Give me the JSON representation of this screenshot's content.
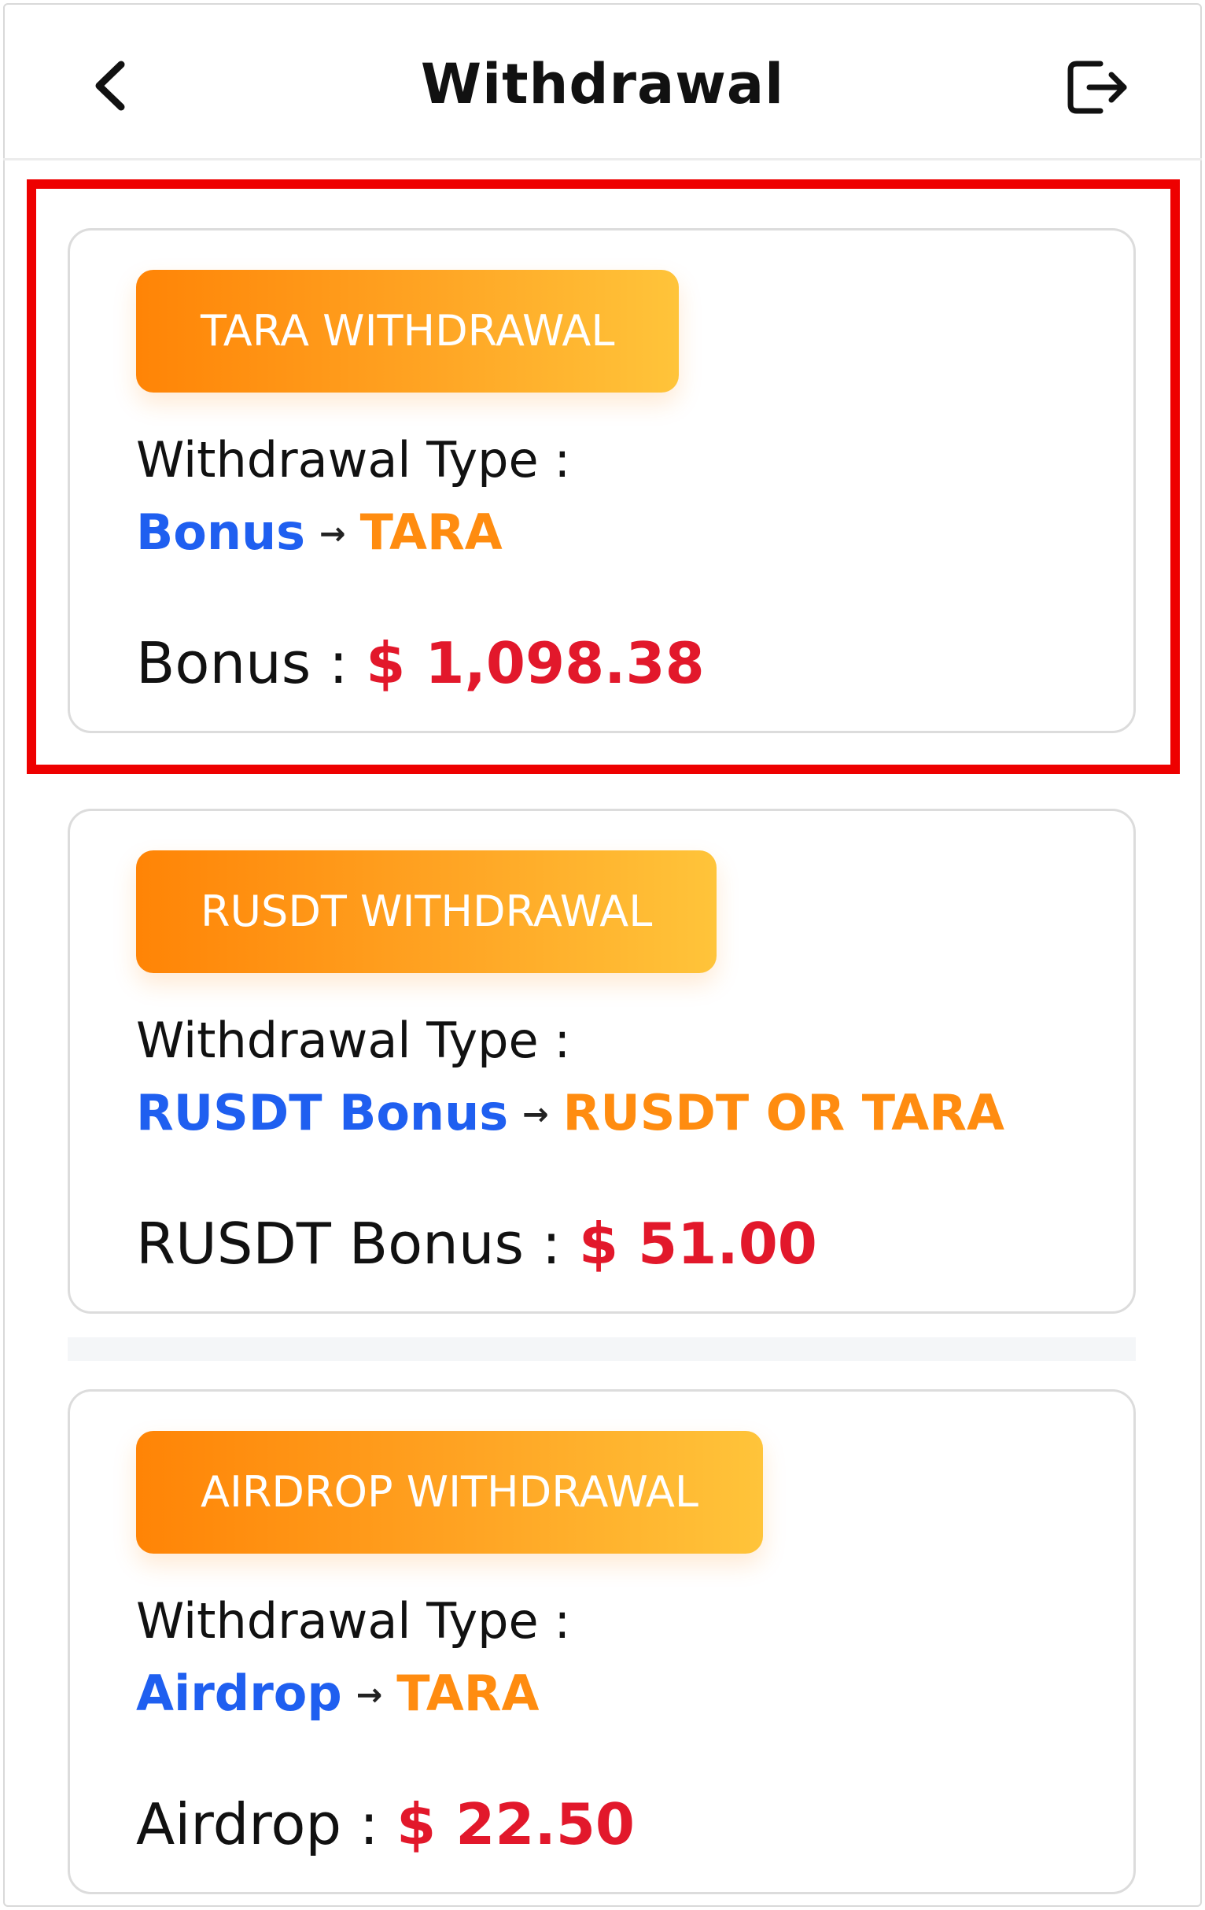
{
  "header": {
    "title": "Withdrawal",
    "back_icon": "chevron-left-icon",
    "logout_icon": "logout-icon"
  },
  "colors": {
    "source": "#1f5ff0",
    "destination": "#ff8c10",
    "amount": "#e2182b",
    "highlight": "#ee0000",
    "badge_start": "#ff8406",
    "badge_end": "#ffc43a"
  },
  "cards": [
    {
      "badge": "TARA WITHDRAWAL",
      "type_label": "Withdrawal Type :",
      "from": "Bonus",
      "arrow": "→",
      "to": "TARA",
      "amount_label": "Bonus :",
      "amount": "$ 1,098.38"
    },
    {
      "badge": "RUSDT WITHDRAWAL",
      "type_label": "Withdrawal Type :",
      "from": "RUSDT Bonus",
      "arrow": "→",
      "to": "RUSDT OR TARA",
      "amount_label": "RUSDT Bonus :",
      "amount": "$ 51.00"
    },
    {
      "badge": "AIRDROP WITHDRAWAL",
      "type_label": "Withdrawal Type :",
      "from": "Airdrop",
      "arrow": "→",
      "to": "TARA",
      "amount_label": "Airdrop :",
      "amount": "$ 22.50"
    }
  ]
}
